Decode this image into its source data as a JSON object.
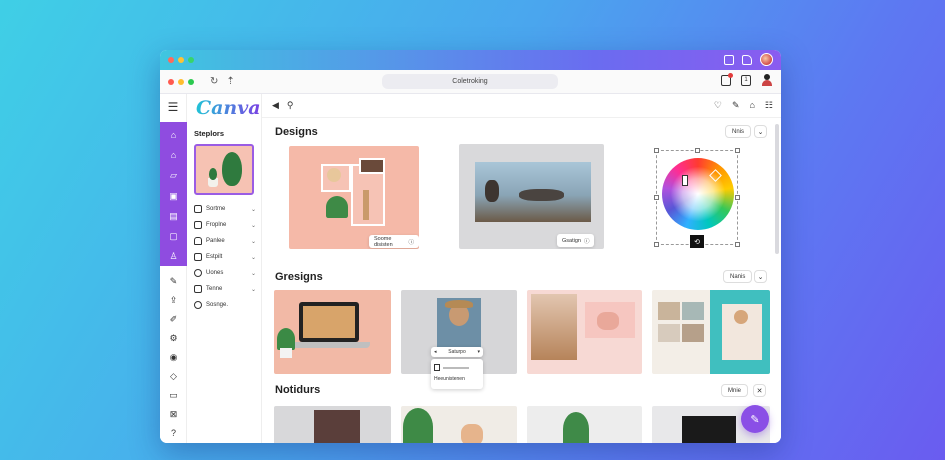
{
  "window": {
    "url": "Coletroking"
  },
  "brand": {
    "logo_text": "Canva"
  },
  "sidebar_panel": {
    "title": "Steplors",
    "items": [
      {
        "label": "Sortme",
        "icon": "square-icon"
      },
      {
        "label": "Froplne",
        "icon": "calendar-icon"
      },
      {
        "label": "Panlee",
        "icon": "home-icon"
      },
      {
        "label": "Estpilt",
        "icon": "grid-icon"
      },
      {
        "label": "Uones",
        "icon": "heart-icon"
      },
      {
        "label": "Tenne",
        "icon": "check-icon"
      },
      {
        "label": "Sosnge.",
        "icon": "plus-circle-icon"
      }
    ]
  },
  "sections": {
    "designs": {
      "title": "Designs",
      "pill": "Nnis",
      "cards": [
        {
          "label": "Soome disisten"
        },
        {
          "label": "Gsatign"
        }
      ]
    },
    "gresigns": {
      "title": "Gresigns",
      "pill": "Nanis",
      "dropdown_header": "Saturpo",
      "dropdown_item": "Heeunistenen"
    },
    "notidurs": {
      "title": "Notidurs",
      "pill": "Mnie",
      "close": "✕"
    }
  },
  "colors": {
    "accent": "#8f4ce0",
    "teal": "#21c3d6",
    "peach": "#f6c2b3"
  }
}
